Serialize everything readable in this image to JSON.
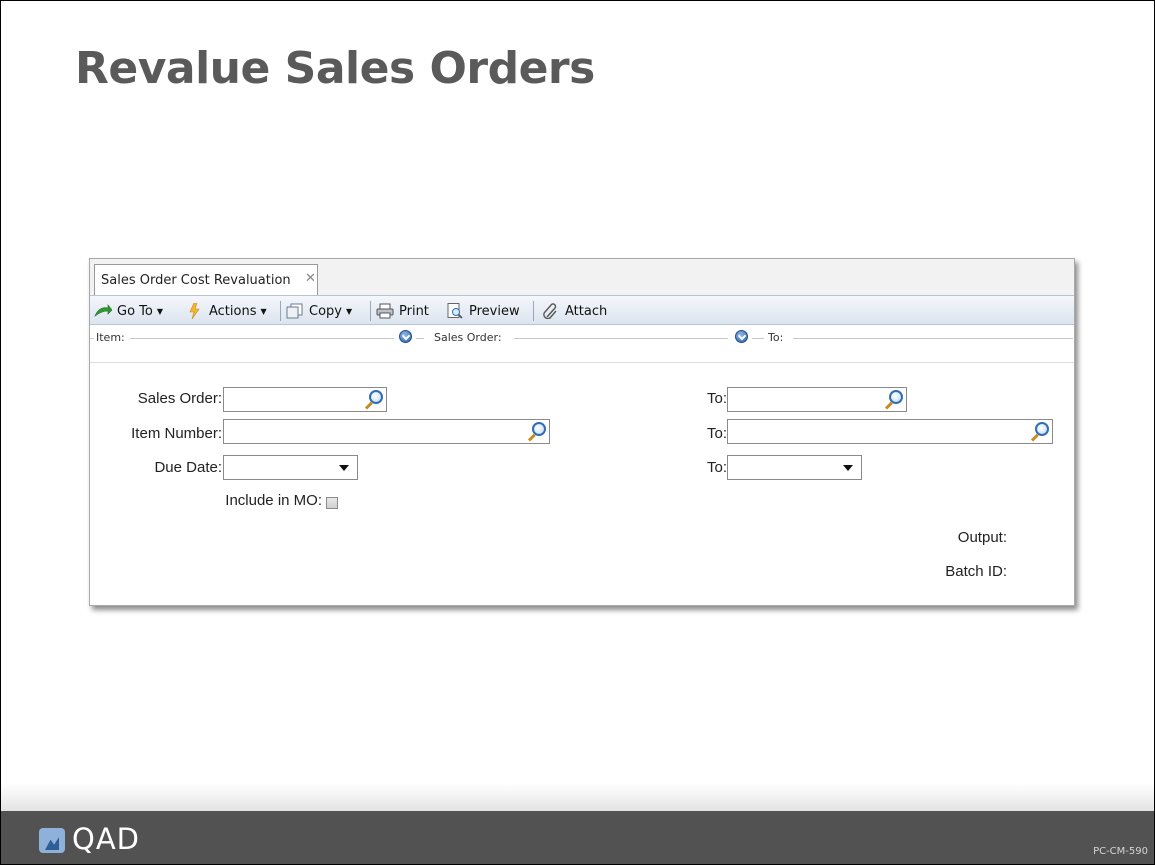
{
  "slide": {
    "title": "Revalue Sales Orders",
    "code": "PC-CM-590",
    "logo_text": "QAD"
  },
  "window": {
    "tab": {
      "label": "Sales Order Cost Revaluation",
      "close": "✕"
    },
    "toolbar": {
      "goto_label": "Go To",
      "actions_label": "Actions",
      "copy_label": "Copy",
      "print_label": "Print",
      "preview_label": "Preview",
      "attach_label": "Attach",
      "caret": "▼"
    },
    "context_bar": {
      "item_label": "Item:",
      "sales_order_label": "Sales Order:",
      "to_label": "To:"
    },
    "form": {
      "sales_order_label": "Sales Order:",
      "sales_order_value": "",
      "sales_order_to_label": "To:",
      "sales_order_to_value": "",
      "item_number_label": "Item Number:",
      "item_number_value": "",
      "item_number_to_label": "To:",
      "item_number_to_value": "",
      "due_date_label": "Due Date:",
      "due_date_value": "",
      "due_date_to_label": "To:",
      "due_date_to_value": "",
      "include_mo_label": "Include in MO:",
      "include_mo_checked": false,
      "output_label": "Output:",
      "batch_id_label": "Batch ID:"
    }
  }
}
